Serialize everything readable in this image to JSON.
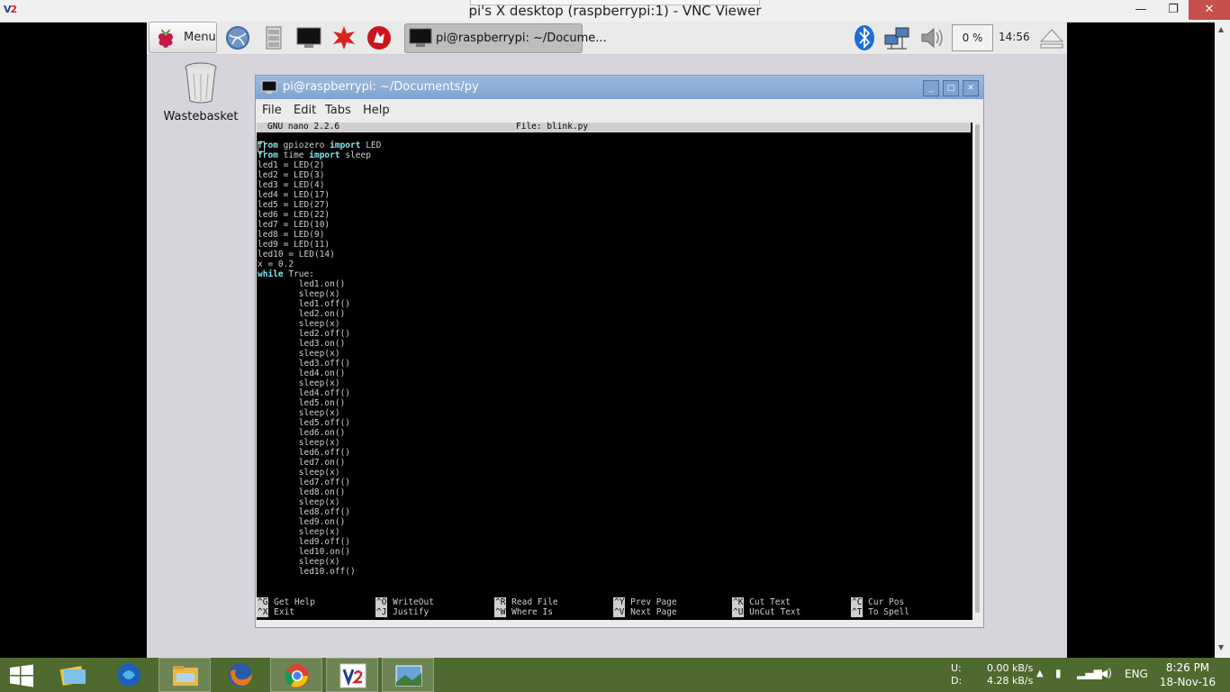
{
  "vnc": {
    "title": "pi's X desktop (raspberrypi:1) - VNC Viewer",
    "logo_v": "V",
    "logo_2": "2",
    "minimize": "—",
    "maximize": "❐",
    "close": "✕"
  },
  "pi_panel": {
    "menu_label": "Menu",
    "task_label": "pi@raspberrypi: ~/Docume...",
    "cpu": "0 %",
    "clock": "14:56"
  },
  "desktop": {
    "wastebasket_label": "Wastebasket"
  },
  "terminal": {
    "title": "pi@raspberrypi: ~/Documents/py",
    "menu": [
      "File",
      "Edit",
      "Tabs",
      "Help"
    ]
  },
  "nano": {
    "version": "GNU nano 2.2.6",
    "file": "File: blink.py",
    "code_lines": [
      "from gpiozero import LED",
      "from time import sleep",
      "led1 = LED(2)",
      "led2 = LED(3)",
      "led3 = LED(4)",
      "led4 = LED(17)",
      "led5 = LED(27)",
      "led6 = LED(22)",
      "led7 = LED(10)",
      "led8 = LED(9)",
      "led9 = LED(11)",
      "led10 = LED(14)",
      "x = 0.2",
      "while True:",
      "        led1.on()",
      "        sleep(x)",
      "        led1.off()",
      "        led2.on()",
      "        sleep(x)",
      "        led2.off()",
      "        led3.on()",
      "        sleep(x)",
      "        led3.off()",
      "        led4.on()",
      "        sleep(x)",
      "        led4.off()",
      "        led5.on()",
      "        sleep(x)",
      "        led5.off()",
      "        led6.on()",
      "        sleep(x)",
      "        led6.off()",
      "        led7.on()",
      "        sleep(x)",
      "        led7.off()",
      "        led8.on()",
      "        sleep(x)",
      "        led8.off()",
      "        led9.on()",
      "        sleep(x)",
      "        led9.off()",
      "        led10.on()",
      "        sleep(x)",
      "        led10.off()"
    ],
    "help": [
      {
        "key": "^G",
        "label": "Get Help"
      },
      {
        "key": "^O",
        "label": "WriteOut"
      },
      {
        "key": "^R",
        "label": "Read File"
      },
      {
        "key": "^Y",
        "label": "Prev Page"
      },
      {
        "key": "^K",
        "label": "Cut Text"
      },
      {
        "key": "^C",
        "label": "Cur Pos"
      },
      {
        "key": "^X",
        "label": "Exit"
      },
      {
        "key": "^J",
        "label": "Justify"
      },
      {
        "key": "^W",
        "label": "Where Is"
      },
      {
        "key": "^V",
        "label": "Next Page"
      },
      {
        "key": "^U",
        "label": "UnCut Text"
      },
      {
        "key": "^T",
        "label": "To Spell"
      }
    ]
  },
  "windows_taskbar": {
    "net_up_label": "U:",
    "net_down_label": "D:",
    "net_up": "0.00 kB/s",
    "net_down": "4.28 kB/s",
    "language": "ENG",
    "time": "8:26 PM",
    "date": "18-Nov-16"
  },
  "colors": {
    "desktop_bg": "#d7d4dc",
    "titlebar": "#7fa3d0",
    "keyword": "#7fe6f0",
    "taskbar": "#4e6a2f"
  }
}
